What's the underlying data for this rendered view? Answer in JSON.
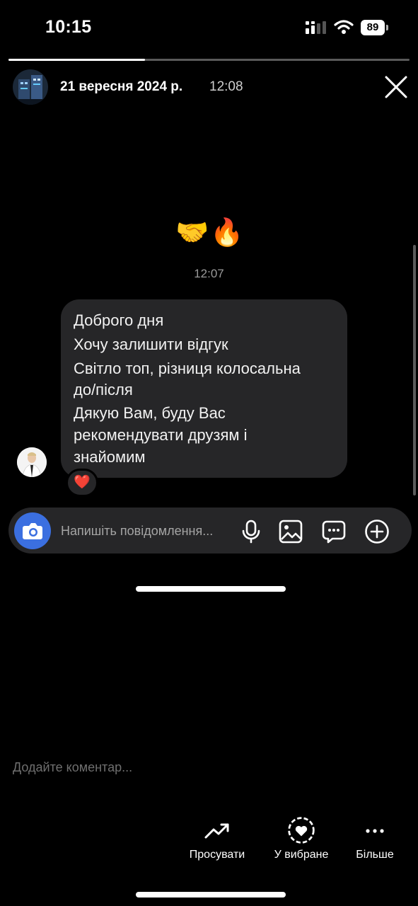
{
  "status_bar": {
    "time": "10:15",
    "battery": "89"
  },
  "story": {
    "date": "21 вересня 2024 р.",
    "time": "12:08",
    "progress_fraction": 0.34
  },
  "chat": {
    "emojis": "🤝🔥",
    "timestamp": "12:07",
    "message_lines": [
      "Доброго дня",
      "Хочу залишити відгук",
      "Світло топ, різниця колосальна",
      "до/після",
      "Дякую Вам, буду Вас",
      "рекомендувати друзям і",
      "знайомим"
    ],
    "reaction": "❤️"
  },
  "composer": {
    "placeholder": "Напишіть повідомлення..."
  },
  "comment": {
    "placeholder": "Додайте коментар..."
  },
  "actions": {
    "promote": "Просувати",
    "favorite": "У вибране",
    "more": "Більше"
  },
  "icons": {
    "camera": "camera-icon",
    "mic": "microphone-icon",
    "image": "image-icon",
    "sticker": "sticker-icon",
    "plus": "plus-icon",
    "close": "close-icon",
    "promote": "trending-up-icon",
    "favorite": "heart-circle-icon",
    "more": "more-dots-icon"
  },
  "colors": {
    "accent": "#3b6fe0",
    "bubble": "#262628",
    "reaction": "#e0245e"
  }
}
